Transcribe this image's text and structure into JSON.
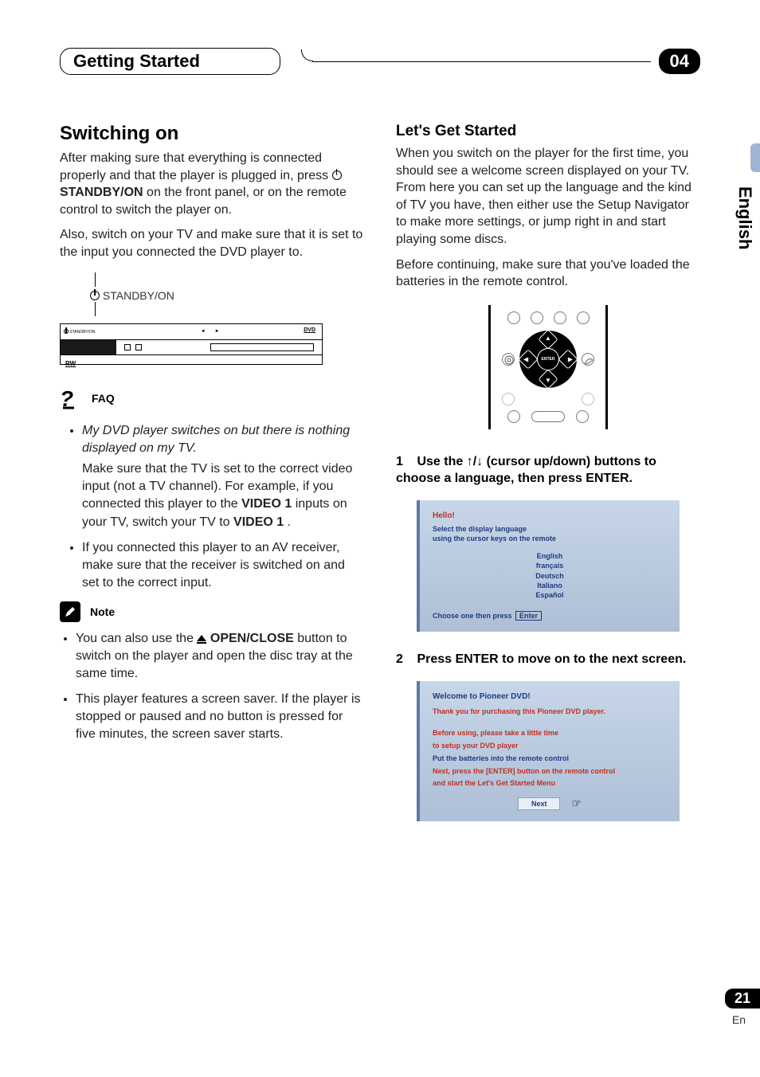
{
  "header": {
    "title": "Getting Started",
    "chapter": "04"
  },
  "side": {
    "language_tab": "English",
    "page_number": "21",
    "page_lang_abbrev": "En"
  },
  "left": {
    "h1": "Switching on",
    "p1a": "After making sure that everything is connected properly and that the player is plugged in, press ",
    "p1b_strong": "STANDBY/ON",
    "p1c": " on the front panel, or on the remote control to switch the player on.",
    "p2": "Also, switch on your TV and make sure that it is set to the input you connected the DVD player to.",
    "panel_label": "STANDBY/ON",
    "panel_standby_tiny": "STANDBY/ON",
    "panel_dvd": "DVD",
    "panel_rw": "RW",
    "faq_label": "FAQ",
    "faq_items": [
      {
        "q": "My DVD player switches on but there is nothing displayed on my TV.",
        "a1": "Make sure that the TV is set to the correct video input (not a TV channel). For example, if you connected this player to the ",
        "a1_strong": "VIDEO 1",
        "a1b": " inputs on your TV, switch your TV to ",
        "a1b_strong": "VIDEO 1",
        "a1c": "."
      },
      {
        "text": "If you connected this player to an AV receiver, make sure that the receiver is switched on and set to the correct input."
      }
    ],
    "note_label": "Note",
    "note_items": [
      {
        "a": "You can also use the ",
        "strong": "OPEN/CLOSE",
        "b": " button to switch on the player and open the disc tray at the same time."
      },
      {
        "text": "This player features a screen saver. If the player is stopped or paused and no button is pressed for five minutes, the screen saver starts."
      }
    ]
  },
  "right": {
    "h2": "Let's Get Started",
    "p1": "When you switch on the player for the first time, you should see a welcome screen displayed on your TV. From here you can set up the language and the kind of TV you have, then either use the Setup Navigator to make more settings, or jump right in and start playing some discs.",
    "p2": "Before continuing, make sure that you've loaded the batteries in the remote control.",
    "remote_enter": "ENTER",
    "step1_num": "1",
    "step1_a": "Use the ",
    "step1_arrows": "↑/↓",
    "step1_b": " (cursor up/down) buttons to choose a language, then press ENTER.",
    "osd1": {
      "hello": "Hello!",
      "sub1": "Select the display language",
      "sub2": "using the cursor keys on the remote",
      "langs": [
        "English",
        "français",
        "Deutsch",
        "Italiano",
        "Español"
      ],
      "foot_a": "Choose one then press",
      "foot_enter": "Enter"
    },
    "step2_num": "2",
    "step2_text": "Press ENTER to move on to the next screen.",
    "osd2": {
      "title": "Welcome to Pioneer DVD!",
      "l1": "Thank you for purchasing this Pioneer DVD player.",
      "l2": "Before using, please take a little time",
      "l3": "to setup your DVD player",
      "l4": "Put the batteries into the remote control",
      "l5": "Next, press the [ENTER] button on the remote control",
      "l6": "and start the Let's Get Started Menu",
      "next": "Next"
    }
  }
}
